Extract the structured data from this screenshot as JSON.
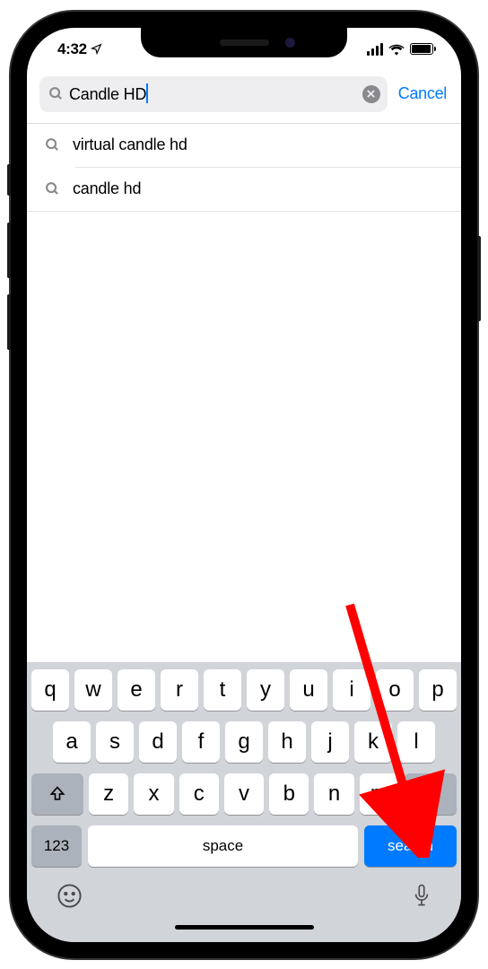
{
  "status": {
    "time": "4:32",
    "locationActive": true
  },
  "search": {
    "value": "Candle HD",
    "cancelLabel": "Cancel"
  },
  "suggestions": [
    {
      "label": "virtual candle hd"
    },
    {
      "label": "candle hd"
    }
  ],
  "keyboard": {
    "row1": [
      "q",
      "w",
      "e",
      "r",
      "t",
      "y",
      "u",
      "i",
      "o",
      "p"
    ],
    "row2": [
      "a",
      "s",
      "d",
      "f",
      "g",
      "h",
      "j",
      "k",
      "l"
    ],
    "row3": [
      "z",
      "x",
      "c",
      "v",
      "b",
      "n",
      "m"
    ],
    "numKey": "123",
    "spaceKey": "space",
    "searchKey": "search"
  }
}
